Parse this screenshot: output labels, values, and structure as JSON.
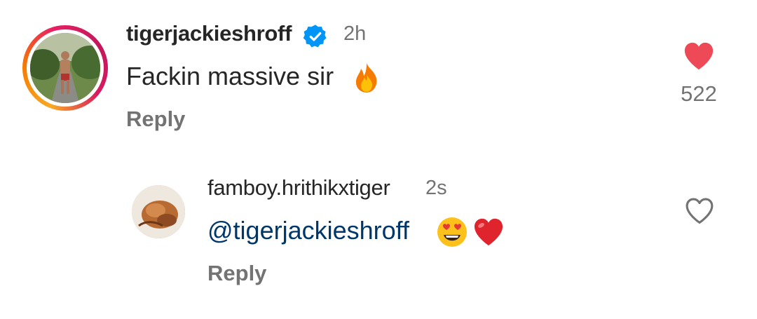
{
  "comments": [
    {
      "username": "tigerjackieshroff",
      "verified": true,
      "time": "2h",
      "text": "Fackin massive sir",
      "emoji": "fire-icon",
      "reply_label": "Reply",
      "liked": true,
      "like_count": "522"
    },
    {
      "username": "famboy.hrithikxtiger",
      "verified": false,
      "time": "2s",
      "mention": "@tigerjackieshroff",
      "emoji": [
        "smiling-heart-eyes-icon",
        "red-heart-icon"
      ],
      "reply_label": "Reply",
      "liked": false
    }
  ],
  "colors": {
    "text": "#262626",
    "secondary": "#737373",
    "mention": "#00376b",
    "like_red": "#ed4956",
    "verified_blue": "#0095f6"
  }
}
